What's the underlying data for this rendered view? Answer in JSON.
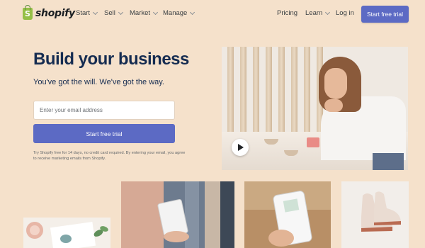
{
  "brand": {
    "name": "shopify",
    "accent_color": "#5c6ac4",
    "logo_color": "#95bf47",
    "text_color": "#152c51"
  },
  "nav": {
    "items": [
      {
        "label": "Start",
        "has_dropdown": true
      },
      {
        "label": "Sell",
        "has_dropdown": true
      },
      {
        "label": "Market",
        "has_dropdown": true
      },
      {
        "label": "Manage",
        "has_dropdown": true
      }
    ],
    "right": {
      "pricing": "Pricing",
      "learn": "Learn",
      "login": "Log in",
      "cta": "Start free trial"
    }
  },
  "hero": {
    "title": "Build your business",
    "subtitle": "You've got the will. We've got the way.",
    "email_placeholder": "Enter your email address",
    "cta": "Start free trial",
    "disclaimer": "Try Shopify free for 14 days, no credit card required. By entering your email, you agree to receive marketing emails from Shopify."
  },
  "video": {
    "play_icon": "play-icon"
  },
  "gallery": {
    "icons": [
      "plant-photo",
      "tablet-photo",
      "phone-photo",
      "shoes-photo"
    ]
  }
}
